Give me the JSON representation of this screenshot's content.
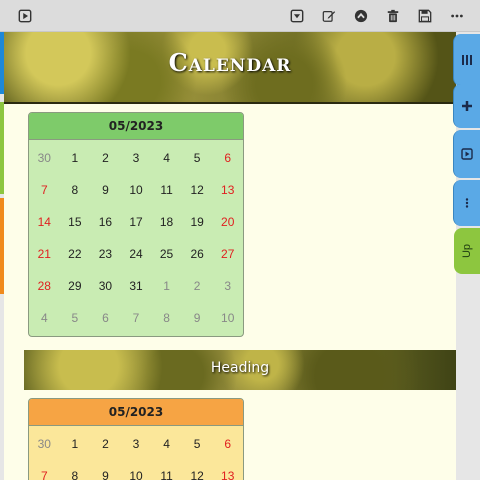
{
  "toolbar": {
    "left_icon": "play-square-icon",
    "right_icons": [
      "dropdown-square-icon",
      "edit-icon",
      "chevron-up-circle-icon",
      "trash-icon",
      "save-icon",
      "more-icon"
    ]
  },
  "page": {
    "banner_title": "Calendar",
    "heading": "Heading"
  },
  "calendars": [
    {
      "month_label": "05/2023",
      "theme": "green",
      "days": [
        {
          "d": "30",
          "t": "other"
        },
        {
          "d": "1",
          "t": ""
        },
        {
          "d": "2",
          "t": ""
        },
        {
          "d": "3",
          "t": ""
        },
        {
          "d": "4",
          "t": ""
        },
        {
          "d": "5",
          "t": ""
        },
        {
          "d": "6",
          "t": "weekend"
        },
        {
          "d": "7",
          "t": "weekend"
        },
        {
          "d": "8",
          "t": ""
        },
        {
          "d": "9",
          "t": ""
        },
        {
          "d": "10",
          "t": ""
        },
        {
          "d": "11",
          "t": ""
        },
        {
          "d": "12",
          "t": ""
        },
        {
          "d": "13",
          "t": "weekend"
        },
        {
          "d": "14",
          "t": "weekend"
        },
        {
          "d": "15",
          "t": ""
        },
        {
          "d": "16",
          "t": ""
        },
        {
          "d": "17",
          "t": ""
        },
        {
          "d": "18",
          "t": ""
        },
        {
          "d": "19",
          "t": ""
        },
        {
          "d": "20",
          "t": "weekend"
        },
        {
          "d": "21",
          "t": "weekend"
        },
        {
          "d": "22",
          "t": ""
        },
        {
          "d": "23",
          "t": ""
        },
        {
          "d": "24",
          "t": ""
        },
        {
          "d": "25",
          "t": ""
        },
        {
          "d": "26",
          "t": ""
        },
        {
          "d": "27",
          "t": "weekend"
        },
        {
          "d": "28",
          "t": "weekend"
        },
        {
          "d": "29",
          "t": ""
        },
        {
          "d": "30",
          "t": ""
        },
        {
          "d": "31",
          "t": ""
        },
        {
          "d": "1",
          "t": "other"
        },
        {
          "d": "2",
          "t": "other"
        },
        {
          "d": "3",
          "t": "other"
        },
        {
          "d": "4",
          "t": "other"
        },
        {
          "d": "5",
          "t": "other"
        },
        {
          "d": "6",
          "t": "other"
        },
        {
          "d": "7",
          "t": "other"
        },
        {
          "d": "8",
          "t": "other"
        },
        {
          "d": "9",
          "t": "other"
        },
        {
          "d": "10",
          "t": "other"
        }
      ]
    },
    {
      "month_label": "05/2023",
      "theme": "orange",
      "days": [
        {
          "d": "30",
          "t": "other"
        },
        {
          "d": "1",
          "t": ""
        },
        {
          "d": "2",
          "t": ""
        },
        {
          "d": "3",
          "t": ""
        },
        {
          "d": "4",
          "t": ""
        },
        {
          "d": "5",
          "t": ""
        },
        {
          "d": "6",
          "t": "weekend"
        },
        {
          "d": "7",
          "t": "weekend"
        },
        {
          "d": "8",
          "t": ""
        },
        {
          "d": "9",
          "t": ""
        },
        {
          "d": "10",
          "t": ""
        },
        {
          "d": "11",
          "t": ""
        },
        {
          "d": "12",
          "t": ""
        },
        {
          "d": "13",
          "t": "weekend"
        }
      ]
    }
  ],
  "side_tabs": [
    {
      "icon": "columns-icon",
      "color": "blue"
    },
    {
      "icon": "plus-icon",
      "color": "blue"
    },
    {
      "icon": "play-square-icon",
      "color": "blue"
    },
    {
      "icon": "vertical-dots-icon",
      "color": "blue"
    },
    {
      "label": "Up",
      "color": "green"
    }
  ],
  "colors": {
    "left_stripe_blue": "#1e88d8",
    "left_stripe_green": "#8dc63f",
    "left_stripe_orange": "#f08a1c"
  }
}
